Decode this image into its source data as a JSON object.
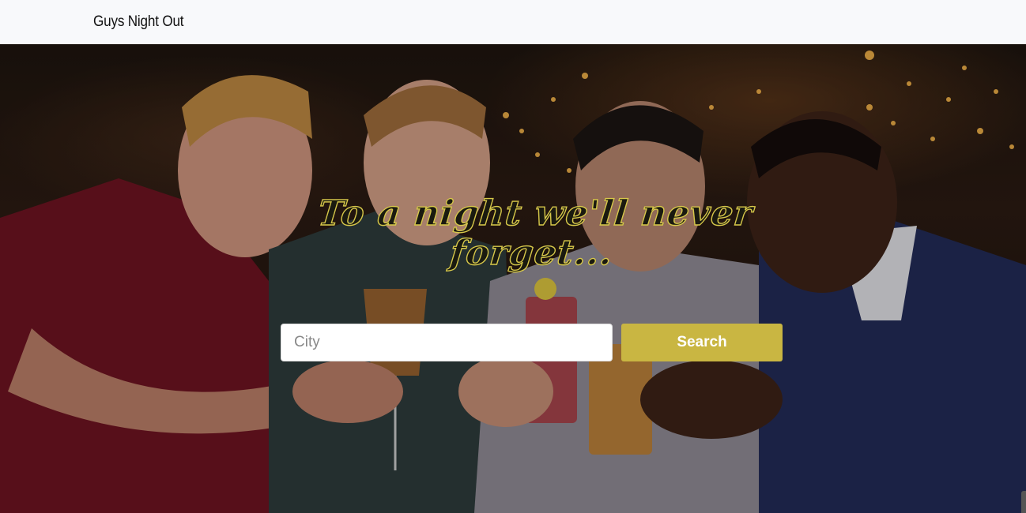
{
  "navbar": {
    "brand": "Guys Night Out"
  },
  "hero": {
    "tagline_line1": "To a night we'll never",
    "tagline_line2": "forget...",
    "search": {
      "placeholder": "City",
      "value": ""
    },
    "search_button_label": "Search"
  },
  "colors": {
    "accent": "#c9b642",
    "navbar_bg": "#f8f9fb",
    "tagline_stroke": "#d7c84a"
  }
}
